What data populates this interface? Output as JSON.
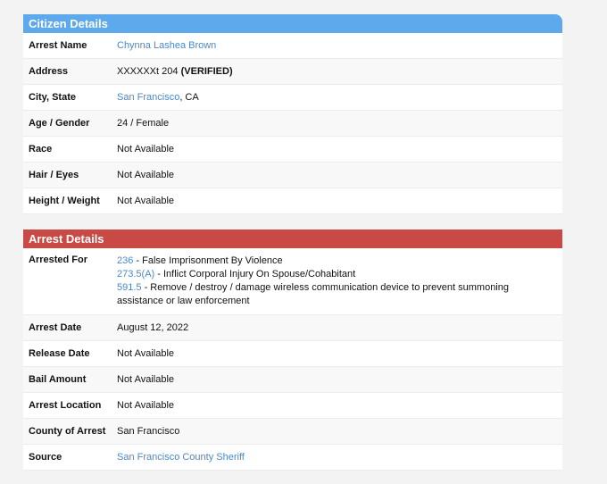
{
  "citizen": {
    "header": "Citizen Details",
    "rows": [
      {
        "label": "Arrest Name",
        "value": "Chynna Lashea Brown"
      },
      {
        "label": "Address",
        "value": "XXXXXXt 204",
        "verified": "(VERIFIED)"
      },
      {
        "label": "City, State",
        "city": "San Francisco",
        "state": ", CA"
      },
      {
        "label": "Age / Gender",
        "value": "24 / Female"
      },
      {
        "label": "Race",
        "value": "Not Available"
      },
      {
        "label": "Hair / Eyes",
        "value": "Not Available"
      },
      {
        "label": "Height / Weight",
        "value": "Not Available"
      }
    ]
  },
  "arrest": {
    "header": "Arrest Details",
    "arrested_for_label": "Arrested For",
    "charges": [
      {
        "code": "236",
        "desc": " - False Imprisonment By Violence"
      },
      {
        "code": "273.5(A)",
        "desc": " - Inflict Corporal Injury On Spouse/Cohabitant"
      },
      {
        "code": "591.5",
        "desc": " - Remove / destroy / damage wireless communication device to prevent summoning assistance or law enforcement"
      }
    ],
    "rows": [
      {
        "label": "Arrest Date",
        "value": "August 12, 2022"
      },
      {
        "label": "Release Date",
        "value": "Not Available"
      },
      {
        "label": "Bail Amount",
        "value": "Not Available"
      },
      {
        "label": "Arrest Location",
        "value": "Not Available"
      },
      {
        "label": "County of Arrest",
        "value": "San Francisco"
      },
      {
        "label": "Source",
        "value": "San Francisco County Sheriff"
      }
    ]
  }
}
